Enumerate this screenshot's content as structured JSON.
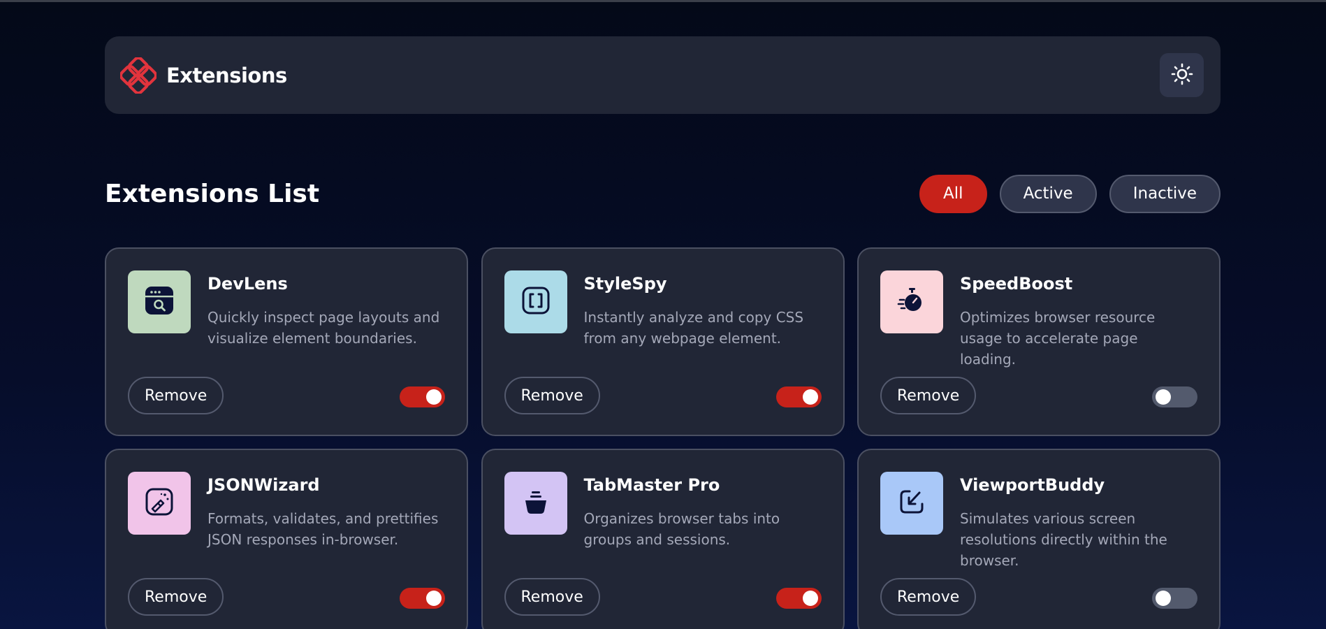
{
  "header": {
    "brand_name": "Extensions",
    "logo_icon": "extensions-logo-icon",
    "theme_icon": "sun-icon",
    "accent_color": "#c7221a"
  },
  "list": {
    "title": "Extensions List",
    "filters": [
      {
        "label": "All",
        "selected": true
      },
      {
        "label": "Active",
        "selected": false
      },
      {
        "label": "Inactive",
        "selected": false
      }
    ]
  },
  "extensions": [
    {
      "name": "DevLens",
      "description": "Quickly inspect page layouts and visualize element boundaries.",
      "icon": "browser-search-icon",
      "icon_bg": "#bfd9be",
      "remove_label": "Remove",
      "active": true
    },
    {
      "name": "StyleSpy",
      "description": "Instantly analyze and copy CSS from any webpage element.",
      "icon": "brackets-icon",
      "icon_bg": "#acdbe8",
      "remove_label": "Remove",
      "active": true
    },
    {
      "name": "SpeedBoost",
      "description": "Optimizes browser resource usage to accelerate page loading.",
      "icon": "stopwatch-icon",
      "icon_bg": "#fbd5da",
      "remove_label": "Remove",
      "active": false
    },
    {
      "name": "JSONWizard",
      "description": "Formats, validates, and prettifies JSON responses in-browser.",
      "icon": "magic-wand-icon",
      "icon_bg": "#f1c4e9",
      "remove_label": "Remove",
      "active": true
    },
    {
      "name": "TabMaster Pro",
      "description": "Organizes browser tabs into groups and sessions.",
      "icon": "stack-icon",
      "icon_bg": "#d3c4f4",
      "remove_label": "Remove",
      "active": true
    },
    {
      "name": "ViewportBuddy",
      "description": "Simulates various screen resolutions directly within the browser.",
      "icon": "resize-arrow-icon",
      "icon_bg": "#a9c8f8",
      "remove_label": "Remove",
      "active": false
    }
  ]
}
